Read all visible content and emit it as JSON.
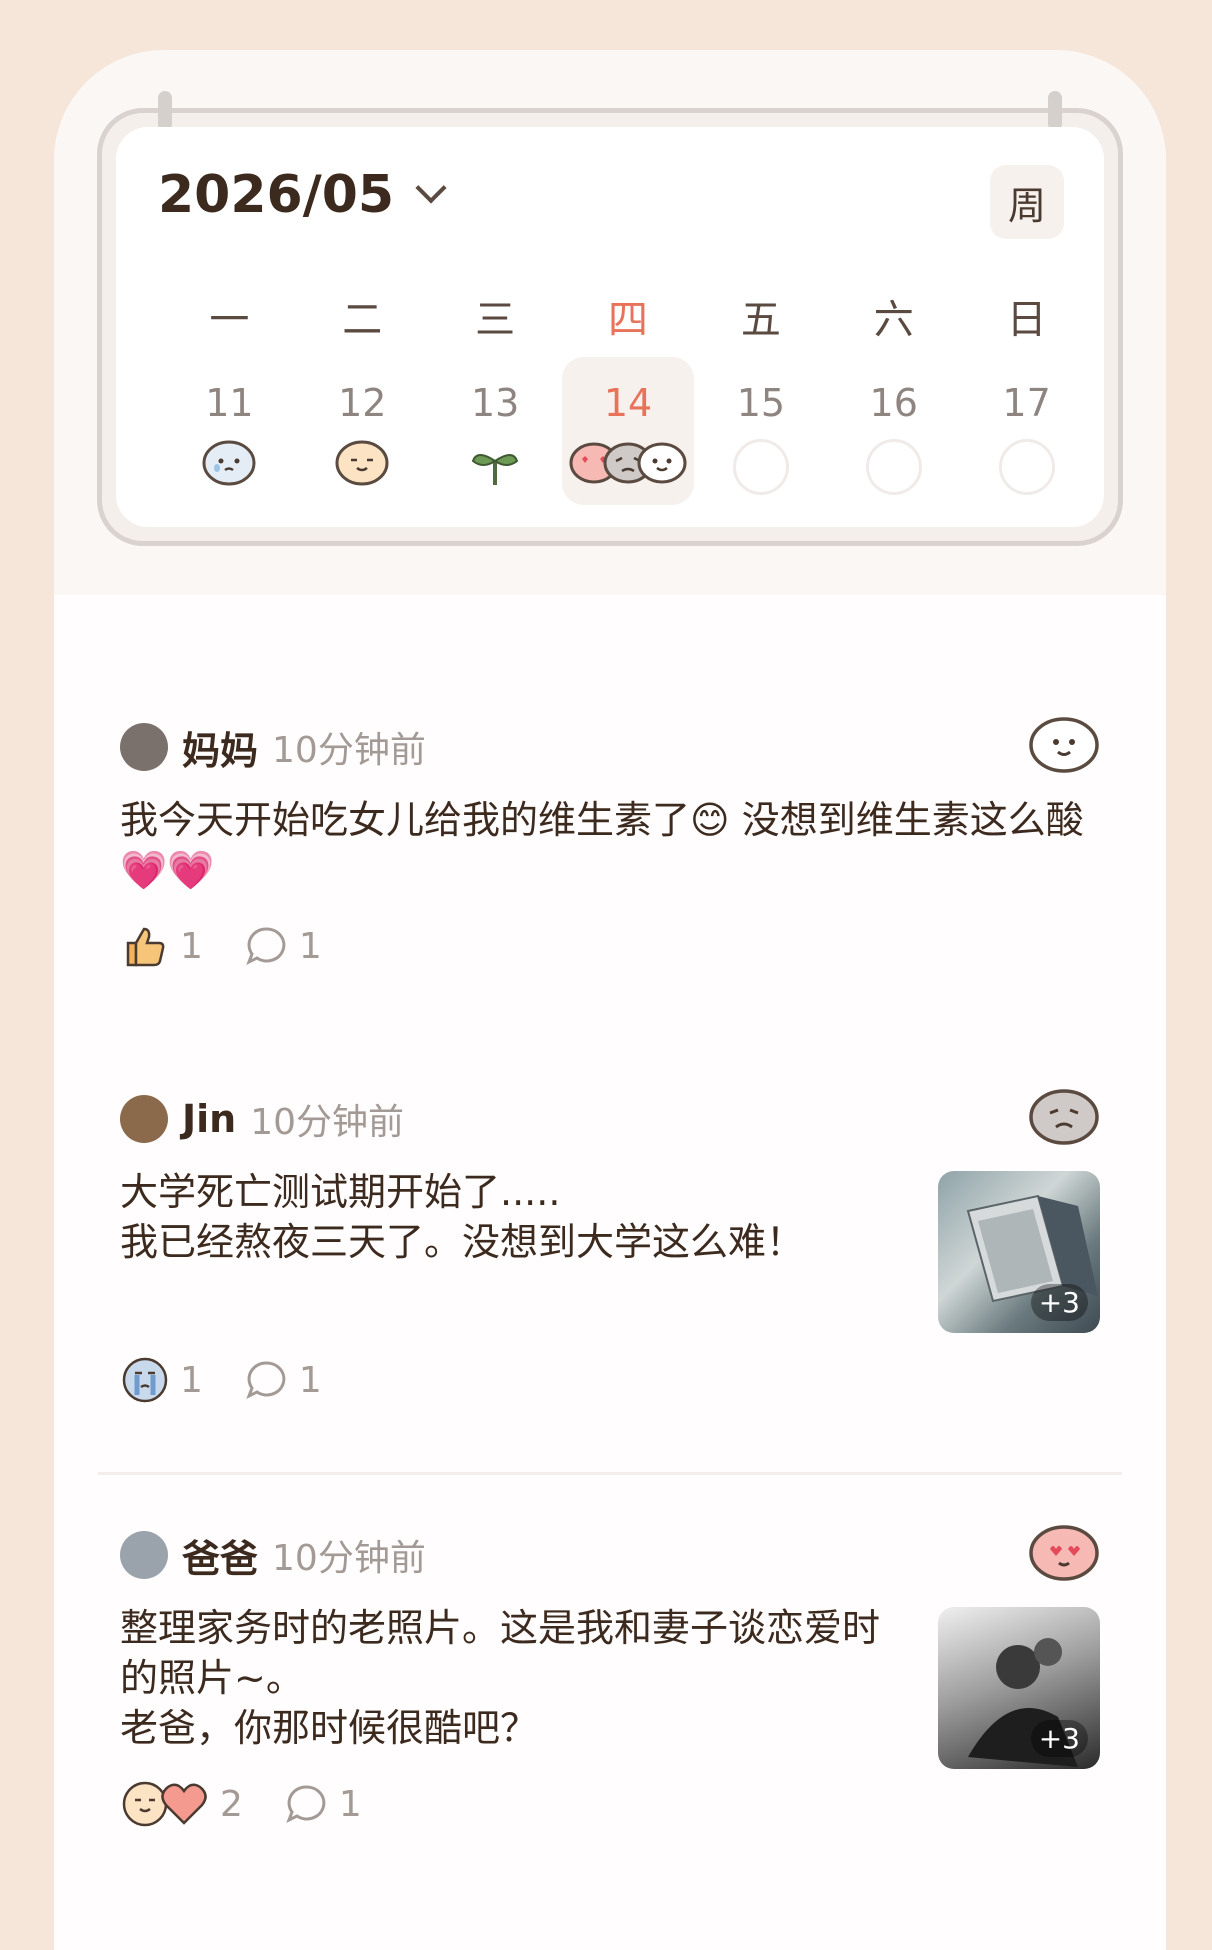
{
  "calendar": {
    "month_label": "2026/05",
    "view_toggle": "周",
    "weekdays": [
      "一",
      "二",
      "三",
      "四",
      "五",
      "六",
      "日"
    ],
    "days": [
      "11",
      "12",
      "13",
      "14",
      "15",
      "16",
      "17"
    ],
    "today_index": 3,
    "day_moods": [
      [
        "sad-face-icon"
      ],
      [
        "content-face-icon"
      ],
      [
        "sprout-icon"
      ],
      [
        "love-face-icon",
        "gloomy-face-icon",
        "smile-face-icon"
      ],
      [],
      [],
      []
    ]
  },
  "posts": [
    {
      "name": "妈妈",
      "time": "10分钟前",
      "mood": "smile-face-icon",
      "text": "我今天开始吃女儿给我的维生素了😊 没想到维生素这么酸💗💗",
      "reactions": [
        {
          "icon": "thumbs-up-icon",
          "count": "1"
        }
      ],
      "comments": "1"
    },
    {
      "name": "Jin",
      "time": "10分钟前",
      "mood": "gloomy-face-icon",
      "text": "大学死亡测试期开始了.....\n我已经熬夜三天了。没想到大学这么难！",
      "image_more": "+3",
      "reactions": [
        {
          "icon": "crying-face-icon",
          "count": "1"
        }
      ],
      "comments": "1"
    },
    {
      "name": "爸爸",
      "time": "10分钟前",
      "mood": "love-face-icon",
      "text": "整理家务时的老照片。这是我和妻子谈恋爱时的照片~。\n老爸，你那时候很酷吧？",
      "image_more": "+3",
      "reactions": [
        {
          "icon": "content-face-icon",
          "count": ""
        },
        {
          "icon": "heart-icon",
          "count": "2"
        }
      ],
      "comments": "1"
    }
  ],
  "colors": {
    "accent": "#e8735a",
    "frame_bg": "#f6e6da",
    "text": "#3d2a1f",
    "muted": "#a39a95"
  }
}
